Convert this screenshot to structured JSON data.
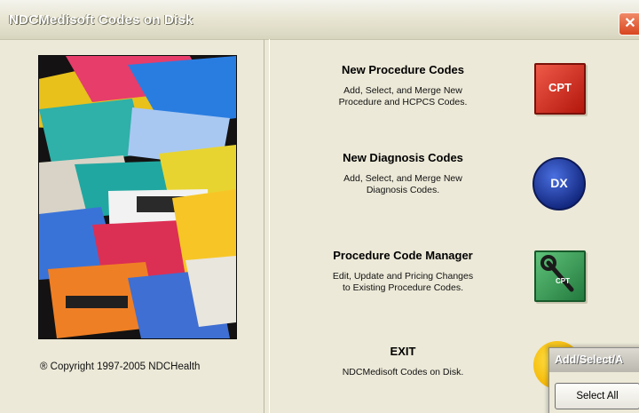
{
  "window": {
    "title": "NDCMedisoft Codes on Disk",
    "close_symbol": "✕"
  },
  "left": {
    "copyright": "® Copyright 1997-2005 NDCHealth"
  },
  "options": [
    {
      "title": "New Procedure Codes",
      "desc_line1": "Add, Select, and Merge New",
      "desc_line2": "Procedure and HCPCS Codes.",
      "icon": "cpt-icon",
      "icon_label": "CPT",
      "icon_color": "#d63a2a"
    },
    {
      "title": "New Diagnosis Codes",
      "desc_line1": "Add, Select, and Merge New",
      "desc_line2": "Diagnosis Codes.",
      "icon": "dx-icon",
      "icon_label": "DX",
      "icon_color": "#1f3ea6"
    },
    {
      "title": "Procedure Code Manager",
      "desc_line1": "Edit, Update and Pricing Changes",
      "desc_line2": "to Existing Procedure Codes.",
      "icon": "wrench-cpt-icon",
      "icon_label": "CPT",
      "icon_color": "#3aa35a"
    },
    {
      "title": "EXIT",
      "desc_line1": "NDCMedisoft Codes on Disk.",
      "icon": "exit-icon",
      "icon_color": "#f4c20d"
    }
  ],
  "popup": {
    "title": "Add/Select/A",
    "button_label": "Select All"
  }
}
